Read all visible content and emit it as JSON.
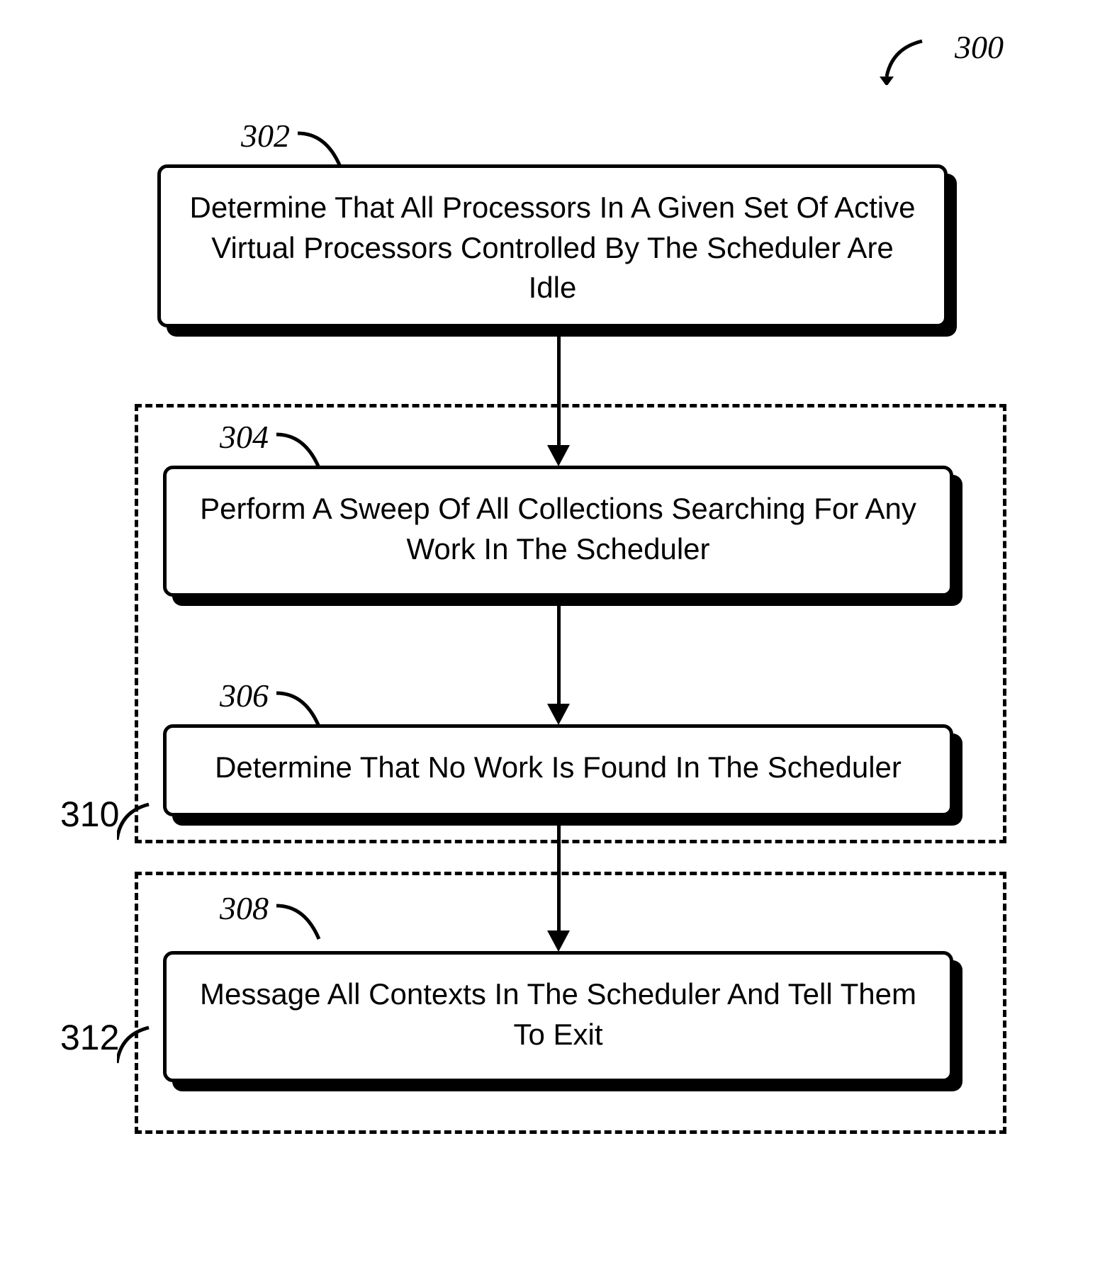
{
  "figureRef": "300",
  "blocks": {
    "b302": {
      "ref": "302",
      "text": "Determine That All Processors In A Given Set Of Active Virtual Processors Controlled By The Scheduler Are Idle"
    },
    "b304": {
      "ref": "304",
      "text": "Perform A Sweep Of All Collections Searching For Any Work In The Scheduler"
    },
    "b306": {
      "ref": "306",
      "text": "Determine That No Work Is Found In The Scheduler"
    },
    "b308": {
      "ref": "308",
      "text": "Message All Contexts In The Scheduler And Tell Them To Exit"
    }
  },
  "groups": {
    "g310": "310",
    "g312": "312"
  }
}
